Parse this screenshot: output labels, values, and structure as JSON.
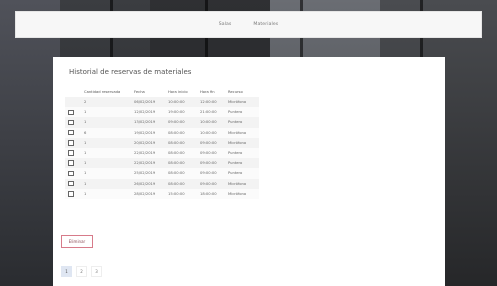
{
  "nav": {
    "link1": "Salas",
    "link2": "Materiales"
  },
  "title": "Historial de reservas de materiales",
  "table": {
    "headers": [
      "",
      "Cantidad reservada",
      "Fecha",
      "Hora inicio",
      "Hora fin",
      "Recurso"
    ],
    "rows": [
      {
        "check": false,
        "qty": "2",
        "date": "06/02/2019",
        "start": "10:00:00",
        "end": "12:00:00",
        "res": "Micrófono"
      },
      {
        "check": true,
        "qty": "1",
        "date": "12/02/2019",
        "start": "19:00:00",
        "end": "21:00:00",
        "res": "Puntero"
      },
      {
        "check": true,
        "qty": "1",
        "date": "13/02/2019",
        "start": "09:00:00",
        "end": "10:00:00",
        "res": "Puntero"
      },
      {
        "check": true,
        "qty": "6",
        "date": "19/02/2019",
        "start": "08:00:00",
        "end": "10:00:00",
        "res": "Micrófono"
      },
      {
        "check": true,
        "qty": "1",
        "date": "20/02/2019",
        "start": "08:00:00",
        "end": "09:00:00",
        "res": "Micrófono"
      },
      {
        "check": true,
        "qty": "1",
        "date": "22/02/2019",
        "start": "08:00:00",
        "end": "09:00:00",
        "res": "Puntero"
      },
      {
        "check": true,
        "qty": "1",
        "date": "22/02/2019",
        "start": "08:00:00",
        "end": "09:00:00",
        "res": "Puntero"
      },
      {
        "check": true,
        "qty": "1",
        "date": "25/02/2019",
        "start": "08:00:00",
        "end": "09:00:00",
        "res": "Puntero"
      },
      {
        "check": true,
        "qty": "1",
        "date": "26/02/2019",
        "start": "08:00:00",
        "end": "09:00:00",
        "res": "Micrófono"
      },
      {
        "check": true,
        "qty": "1",
        "date": "28/02/2019",
        "start": "15:00:00",
        "end": "18:00:00",
        "res": "Micrófono"
      }
    ]
  },
  "delete_label": "Eliminar",
  "pagination": [
    "1",
    "2",
    "3"
  ]
}
